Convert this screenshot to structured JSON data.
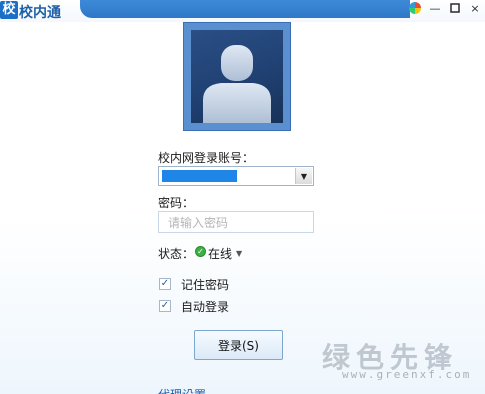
{
  "window": {
    "title": "校内通",
    "logo_char": "校",
    "controls": {
      "minimize": "—",
      "close": "×"
    }
  },
  "form": {
    "account_label": "校内网登录账号：",
    "password_label": "密码：",
    "password_placeholder": "请输入密码",
    "status_label": "状态：",
    "status_value": "在线",
    "remember_label": "记住密码",
    "auto_login_label": "自动登录",
    "remember_checked": true,
    "auto_login_checked": true
  },
  "login_button": "登录(S)",
  "proxy_link": "代理设置",
  "watermark": {
    "title": "绿色先锋",
    "url": "www.greenxf.com"
  },
  "colors": {
    "accent": "#1f86e8",
    "title_blue": "#1f5fa8",
    "status_green": "#3cb043"
  }
}
